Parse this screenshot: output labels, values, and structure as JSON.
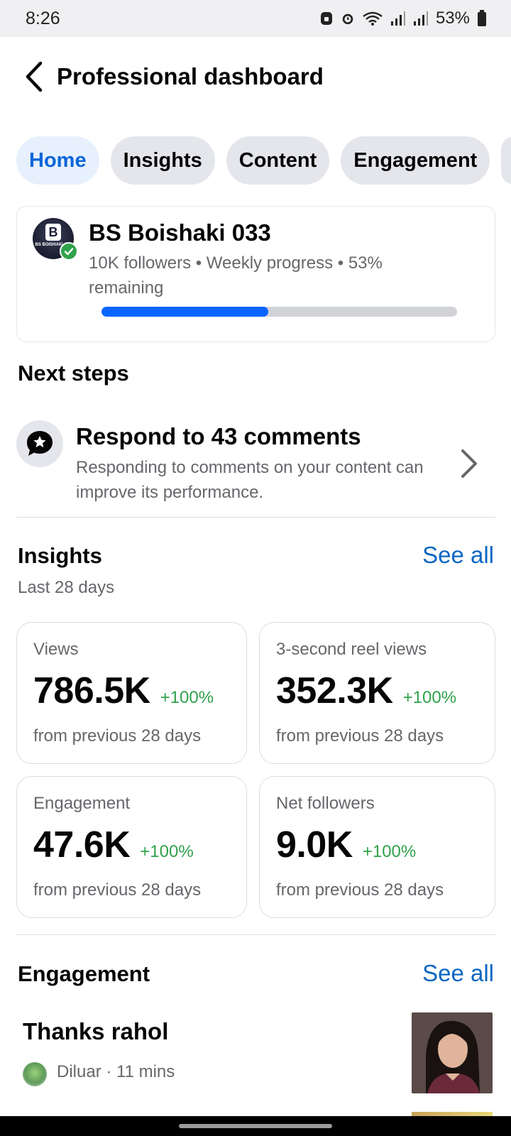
{
  "status_bar": {
    "time": "8:26",
    "battery": "53%"
  },
  "header": {
    "title": "Professional dashboard"
  },
  "tabs": [
    {
      "label": "Home",
      "active": true
    },
    {
      "label": "Insights",
      "active": false
    },
    {
      "label": "Content",
      "active": false
    },
    {
      "label": "Engagement",
      "active": false
    }
  ],
  "profile": {
    "avatar_letter": "B",
    "avatar_caption": "BS BOISHAKI 033",
    "name": "BS Boishaki 033",
    "meta": "10K followers • Weekly progress • 53% remaining",
    "progress_completed_fraction": 0.47
  },
  "next_steps": {
    "title": "Next steps",
    "item": {
      "title": "Respond to 43 comments",
      "description": "Responding to comments on your content can improve its performance."
    }
  },
  "insights": {
    "title": "Insights",
    "see_all": "See all",
    "period": "Last 28 days",
    "metrics": [
      {
        "label": "Views",
        "value": "786.5K",
        "change": "+100%",
        "footnote": "from previous 28 days"
      },
      {
        "label": "3-second reel views",
        "value": "352.3K",
        "change": "+100%",
        "footnote": "from previous 28 days"
      },
      {
        "label": "Engagement",
        "value": "47.6K",
        "change": "+100%",
        "footnote": "from previous 28 days"
      },
      {
        "label": "Net followers",
        "value": "9.0K",
        "change": "+100%",
        "footnote": "from previous 28 days"
      }
    ]
  },
  "engagement": {
    "title": "Engagement",
    "see_all": "See all",
    "item": {
      "title": "Thanks rahol",
      "meta": "Diluar · 11 mins"
    }
  },
  "colors": {
    "accent_blue": "#0866ff",
    "link_blue": "#0a66c2",
    "positive_green": "#31a24c",
    "active_tab_bg": "#e7f0fd"
  }
}
